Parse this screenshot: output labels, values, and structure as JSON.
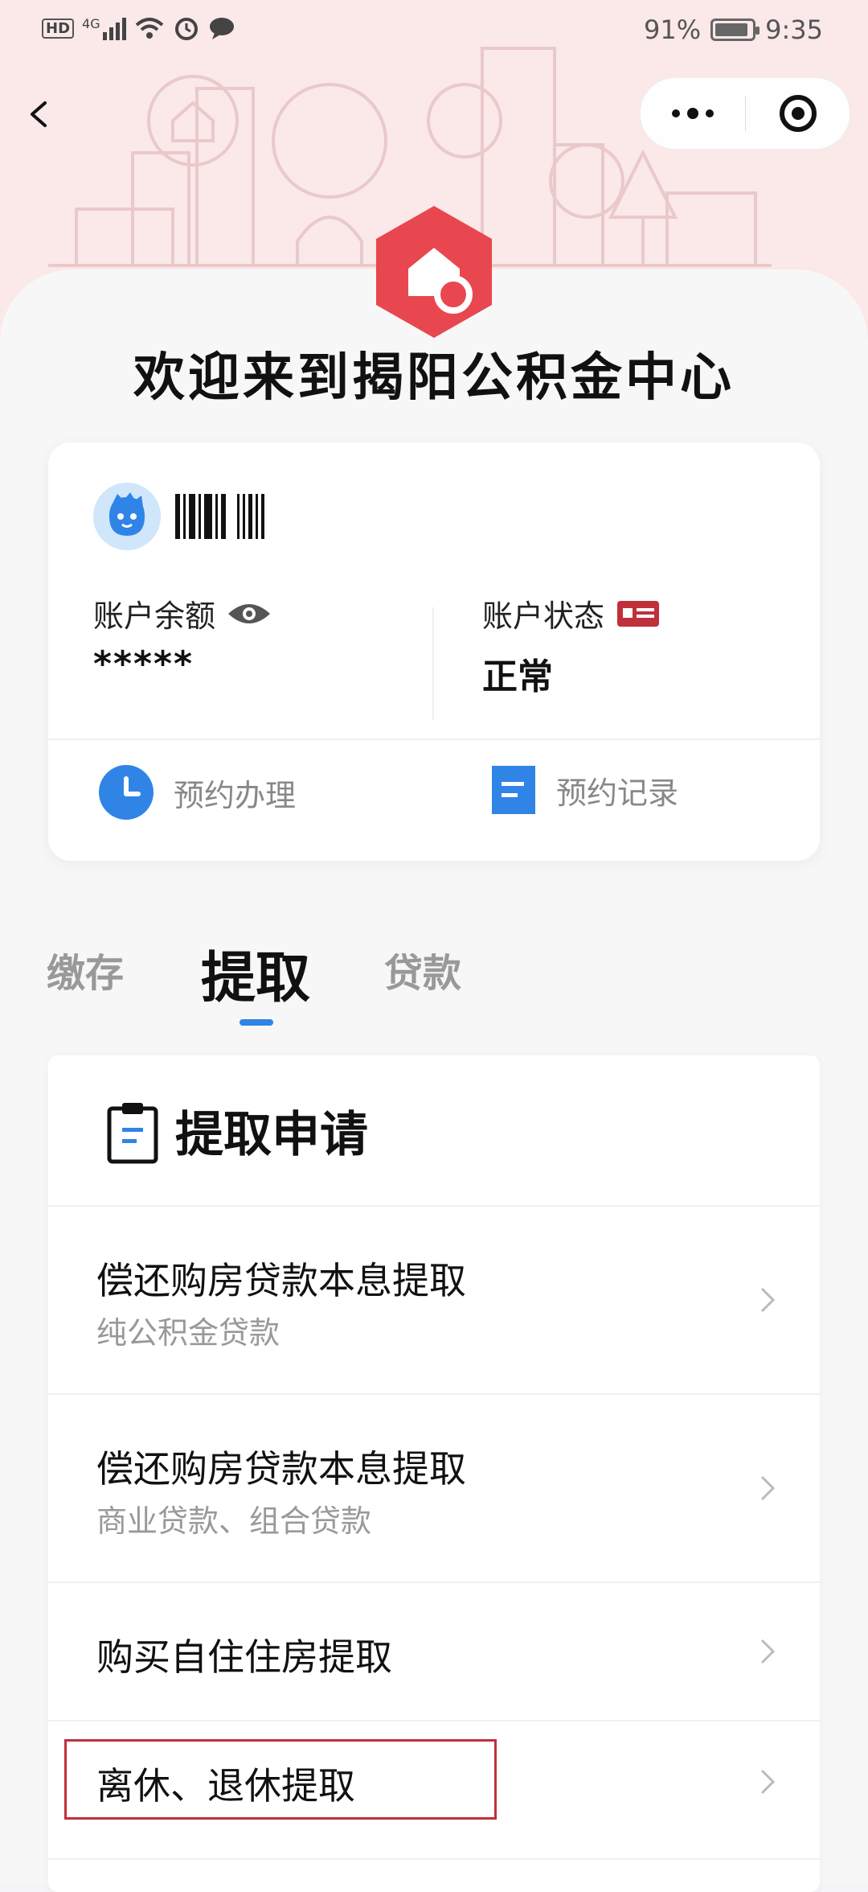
{
  "status_bar": {
    "left_icons": [
      "hd-icon",
      "4g-signal-icon",
      "wifi-icon",
      "alarm-icon",
      "chat-icon"
    ],
    "left_text": "HD",
    "network_label": "4G",
    "battery": "91%",
    "battery_level": 0.91,
    "time": "9:35"
  },
  "nav": {
    "back_icon": "chevron-left-icon",
    "more_icon": "more-dots-icon",
    "close_icon": "target-circle-icon"
  },
  "header": {
    "welcome": "欢迎来到揭阳公积金中心"
  },
  "account_card": {
    "balance_label": "账户余额",
    "balance_value": "*****",
    "status_label": "账户状态",
    "status_value": "正常",
    "actions": [
      {
        "label": "预约办理",
        "icon": "clock-icon"
      },
      {
        "label": "预约记录",
        "icon": "document-icon"
      }
    ]
  },
  "tabs": [
    {
      "label": "缴存",
      "active": false
    },
    {
      "label": "提取",
      "active": true
    },
    {
      "label": "贷款",
      "active": false
    }
  ],
  "panel": {
    "title": "提取申请",
    "items": [
      {
        "title": "偿还购房贷款本息提取",
        "subtitle": "纯公积金贷款"
      },
      {
        "title": "偿还购房贷款本息提取",
        "subtitle": "商业贷款、组合贷款"
      },
      {
        "title": "购买自住住房提取",
        "subtitle": ""
      },
      {
        "title": "离休、退休提取",
        "subtitle": ""
      }
    ]
  },
  "colors": {
    "brand_red": "#e8474f",
    "accent_blue": "#2f84e6",
    "hero_bg": "#fbe8e8",
    "highlight_border": "#c0303a"
  }
}
